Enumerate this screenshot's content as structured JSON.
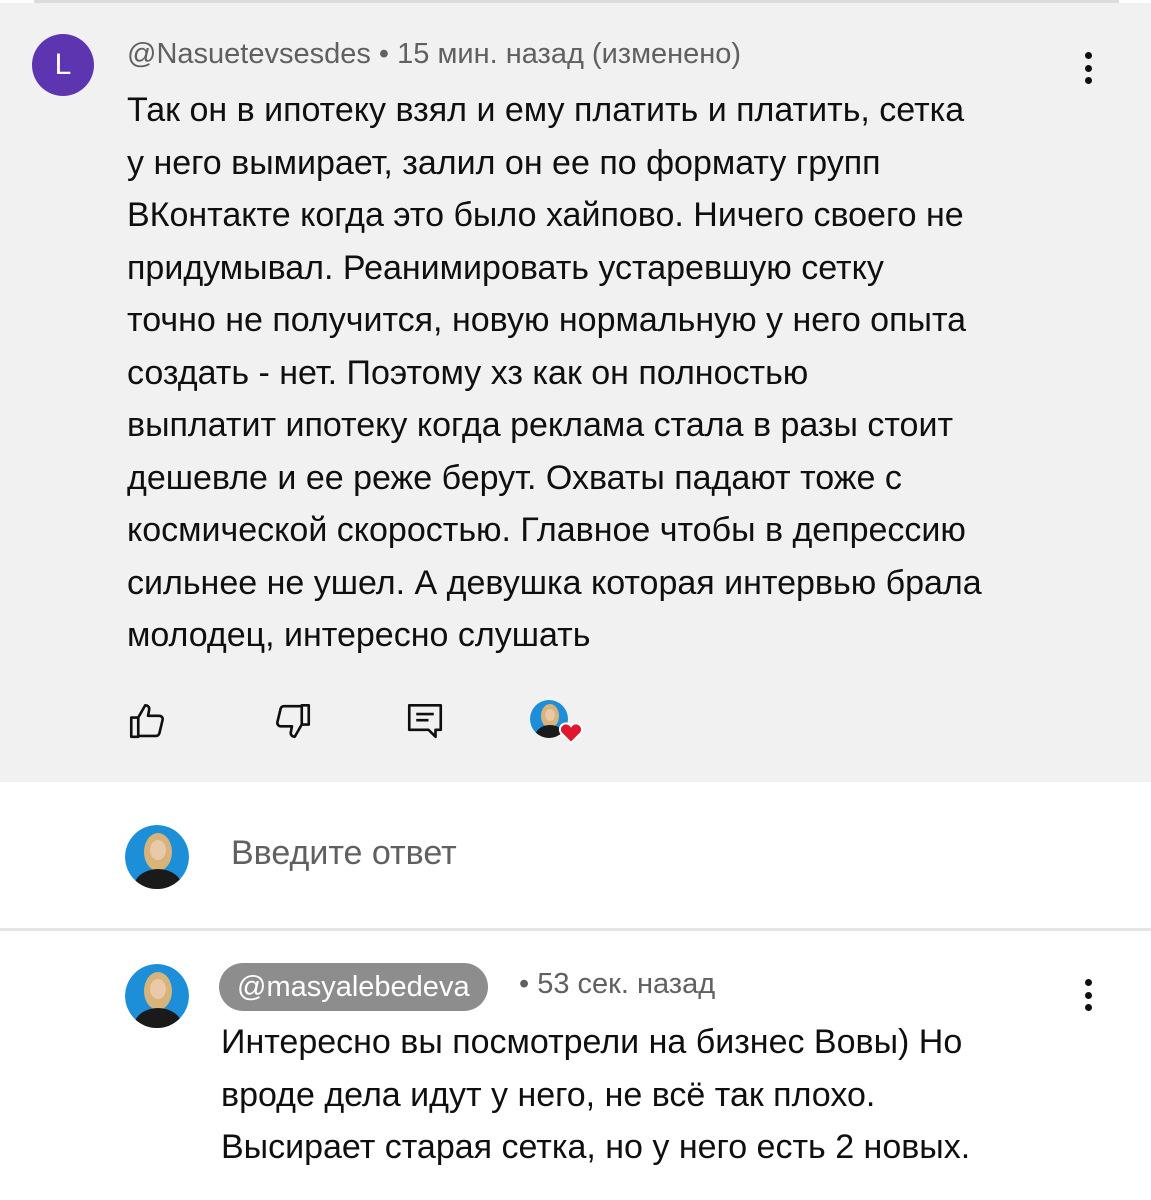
{
  "comment": {
    "avatar_letter": "L",
    "author": "@Nasuetevsesdes",
    "meta_separator": " • ",
    "time": "15 мин. назад (изменено)",
    "lines": [
      "Так он в ипотеку взял и ему платить и платить, сетка",
      "у него вымирает, залил он ее по формату групп",
      "ВКонтакте когда это было хайпово. Ничего своего не",
      "придумывал. Реанимировать устаревшую сетку",
      "точно не получится, новую нормальную у него опыта",
      "создать - нет. Поэтому хз как он полностью",
      "выплатит ипотеку когда реклама стала в разы стоит",
      "дешевле и ее реже берут. Охваты падают тоже с",
      "космической скоростью. Главное чтобы в депрессию",
      "сильнее не ушел. А девушка которая интервью брала",
      "молодец, интересно слушать"
    ],
    "actions": {
      "like_icon": "thumb-up-icon",
      "dislike_icon": "thumb-down-icon",
      "reply_icon": "comment-reply-icon",
      "creator_heart_icon": "creator-heart-icon"
    }
  },
  "reply_box": {
    "placeholder": "Введите ответ"
  },
  "reply": {
    "author": "@masyalebedeva",
    "time": "• 53 сек. назад",
    "lines": [
      "Интересно вы посмотрели на бизнес Вовы) Но",
      "вроде дела идут у него, не всё так плохо.",
      "Высирает старая сетка, но у него есть 2 новых."
    ]
  },
  "colors": {
    "avatar_bg": "#5e35b1",
    "heart": "#e0182f",
    "pill_bg": "#8d8d8d",
    "comment_bg": "#f1f1f1"
  }
}
